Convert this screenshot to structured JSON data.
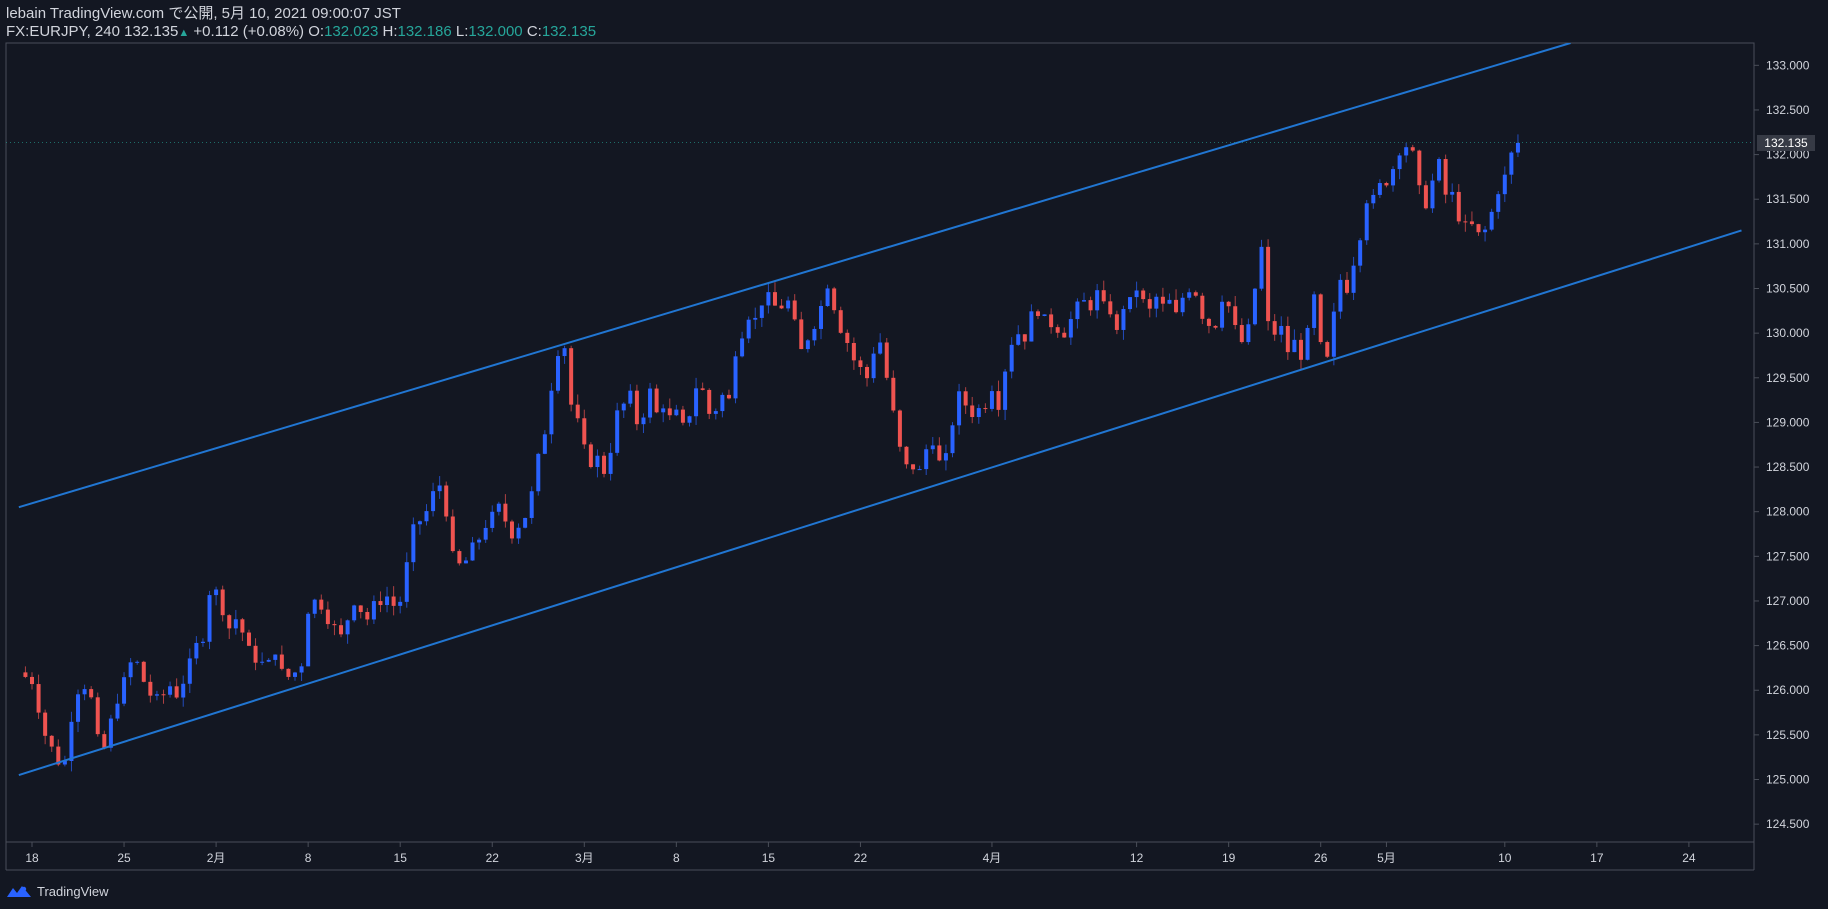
{
  "header": {
    "line1": "lebain TradingView.com で公開, 5月 10, 2021 09:00:07 JST",
    "symbol": "FX:EURJPY, 240",
    "last": "132.135",
    "up_glyph": "▲",
    "change": "+0.112 (+0.08%)",
    "o_label": "O:",
    "o": "132.023",
    "h_label": "H:",
    "h": "132.186",
    "l_label": "L:",
    "l": "132.000",
    "c_label": "C:",
    "c": "132.135"
  },
  "footer": {
    "brand": "TradingView",
    "logo_icon": "tradingview-logo-icon"
  },
  "colors": {
    "background": "#131722",
    "up": "#2962ff",
    "up_line": "#2e7bd6",
    "down": "#ef5350",
    "channel": "#2176d2",
    "axis_text": "#d1d4dc",
    "axis_line": "#4a4e59"
  },
  "chart_data": {
    "type": "candlestick",
    "symbol": "FX:EURJPY",
    "timeframe": "240",
    "ylim": [
      124.3,
      133.25
    ],
    "y_ticks": [
      "124.500",
      "125.000",
      "125.500",
      "126.000",
      "126.500",
      "127.000",
      "127.500",
      "128.000",
      "128.500",
      "129.000",
      "129.500",
      "130.000",
      "130.500",
      "131.000",
      "131.500",
      "132.000",
      "132.500",
      "133.000"
    ],
    "x_ticks": [
      {
        "label": "18",
        "day": 0
      },
      {
        "label": "25",
        "day": 7
      },
      {
        "label": "2月",
        "day": 14
      },
      {
        "label": "8",
        "day": 21
      },
      {
        "label": "15",
        "day": 28
      },
      {
        "label": "22",
        "day": 35
      },
      {
        "label": "3月",
        "day": 42
      },
      {
        "label": "8",
        "day": 49
      },
      {
        "label": "15",
        "day": 56
      },
      {
        "label": "22",
        "day": 63
      },
      {
        "label": "4月",
        "day": 73
      },
      {
        "label": "12",
        "day": 84
      },
      {
        "label": "19",
        "day": 91
      },
      {
        "label": "26",
        "day": 98
      },
      {
        "label": "5月",
        "day": 103
      },
      {
        "label": "10",
        "day": 112
      },
      {
        "label": "17",
        "day": 119
      },
      {
        "label": "24",
        "day": 126
      }
    ],
    "last_price": "132.135",
    "close_path": [
      [
        -1,
        126.2
      ],
      [
        0,
        126.1
      ],
      [
        1,
        125.5
      ],
      [
        2,
        125.2
      ],
      [
        2.5,
        125.2
      ],
      [
        3,
        125.7
      ],
      [
        3.5,
        126.0
      ],
      [
        4,
        126.05
      ],
      [
        4.5,
        125.9
      ],
      [
        5,
        125.45
      ],
      [
        5.5,
        125.35
      ],
      [
        6,
        125.65
      ],
      [
        6.5,
        125.9
      ],
      [
        7,
        126.1
      ],
      [
        7.5,
        126.3
      ],
      [
        8,
        126.3
      ],
      [
        8.5,
        126.1
      ],
      [
        9,
        125.95
      ],
      [
        9.5,
        125.9
      ],
      [
        10,
        125.95
      ],
      [
        10.5,
        126.05
      ],
      [
        11,
        125.95
      ],
      [
        11.5,
        126.1
      ],
      [
        12,
        126.3
      ],
      [
        12.5,
        126.5
      ],
      [
        13,
        126.6
      ],
      [
        13.5,
        127.1
      ],
      [
        14,
        127.1
      ],
      [
        14.5,
        126.9
      ],
      [
        15,
        126.7
      ],
      [
        15.5,
        126.8
      ],
      [
        16,
        126.65
      ],
      [
        16.5,
        126.45
      ],
      [
        17,
        126.35
      ],
      [
        17.5,
        126.3
      ],
      [
        18,
        126.3
      ],
      [
        18.5,
        126.45
      ],
      [
        19,
        126.2
      ],
      [
        19.5,
        126.15
      ],
      [
        20,
        126.2
      ],
      [
        20.5,
        126.3
      ],
      [
        21,
        126.9
      ],
      [
        21.5,
        127.0
      ],
      [
        22,
        126.95
      ],
      [
        22.5,
        126.8
      ],
      [
        23,
        126.7
      ],
      [
        23.5,
        126.6
      ],
      [
        24,
        126.8
      ],
      [
        24.5,
        127.0
      ],
      [
        25,
        126.9
      ],
      [
        25.5,
        126.8
      ],
      [
        26,
        126.95
      ],
      [
        26.5,
        127.0
      ],
      [
        27,
        127.05
      ],
      [
        27.5,
        126.95
      ],
      [
        28,
        127.0
      ],
      [
        28.5,
        127.4
      ],
      [
        29,
        127.8
      ],
      [
        29.5,
        127.9
      ],
      [
        30,
        128.0
      ],
      [
        30.5,
        128.2
      ],
      [
        31,
        128.3
      ],
      [
        31.5,
        128.0
      ],
      [
        32,
        127.5
      ],
      [
        32.5,
        127.4
      ],
      [
        33,
        127.45
      ],
      [
        33.5,
        127.6
      ],
      [
        34,
        127.7
      ],
      [
        34.5,
        127.85
      ],
      [
        35,
        127.95
      ],
      [
        35.5,
        128.05
      ],
      [
        36,
        127.9
      ],
      [
        36.5,
        127.75
      ],
      [
        37,
        127.85
      ],
      [
        37.5,
        127.95
      ],
      [
        38,
        128.2
      ],
      [
        38.5,
        128.6
      ],
      [
        39,
        128.9
      ],
      [
        39.5,
        129.4
      ],
      [
        40,
        129.8
      ],
      [
        40.5,
        129.85
      ],
      [
        41,
        129.2
      ],
      [
        41.5,
        129.0
      ],
      [
        42,
        128.7
      ],
      [
        42.5,
        128.55
      ],
      [
        43,
        128.6
      ],
      [
        43.5,
        128.45
      ],
      [
        44,
        128.7
      ],
      [
        44.5,
        129.1
      ],
      [
        45,
        129.2
      ],
      [
        45.5,
        129.3
      ],
      [
        46,
        129.0
      ],
      [
        46.5,
        129.1
      ],
      [
        47,
        129.35
      ],
      [
        47.5,
        129.1
      ],
      [
        48,
        129.2
      ],
      [
        48.5,
        129.05
      ],
      [
        49,
        129.1
      ],
      [
        49.5,
        128.95
      ],
      [
        50,
        129.1
      ],
      [
        50.5,
        129.4
      ],
      [
        51,
        129.35
      ],
      [
        51.5,
        129.1
      ],
      [
        52,
        129.15
      ],
      [
        52.5,
        129.3
      ],
      [
        53,
        129.25
      ],
      [
        53.5,
        129.8
      ],
      [
        54,
        130.0
      ],
      [
        54.5,
        130.2
      ],
      [
        55,
        130.15
      ],
      [
        55.5,
        130.35
      ],
      [
        56,
        130.4
      ],
      [
        56.5,
        130.3
      ],
      [
        57,
        130.3
      ],
      [
        57.5,
        130.35
      ],
      [
        58,
        130.1
      ],
      [
        58.5,
        129.8
      ],
      [
        59,
        129.95
      ],
      [
        59.5,
        130.1
      ],
      [
        60,
        130.3
      ],
      [
        60.5,
        130.55
      ],
      [
        61,
        130.3
      ],
      [
        61.5,
        130.05
      ],
      [
        62,
        129.9
      ],
      [
        62.5,
        129.7
      ],
      [
        63,
        129.6
      ],
      [
        63.5,
        129.5
      ],
      [
        64,
        129.8
      ],
      [
        64.5,
        129.9
      ],
      [
        65,
        129.5
      ],
      [
        65.5,
        129.1
      ],
      [
        66,
        128.7
      ],
      [
        66.5,
        128.5
      ],
      [
        67,
        128.5
      ],
      [
        67.5,
        128.45
      ],
      [
        68,
        128.7
      ],
      [
        68.5,
        128.8
      ],
      [
        69,
        128.55
      ],
      [
        69.5,
        128.6
      ],
      [
        70,
        129.0
      ],
      [
        70.5,
        129.3
      ],
      [
        71,
        129.2
      ],
      [
        71.5,
        129.1
      ],
      [
        72,
        129.15
      ],
      [
        72.5,
        129.2
      ],
      [
        73,
        129.4
      ],
      [
        73.5,
        129.2
      ],
      [
        74,
        129.6
      ],
      [
        74.5,
        129.9
      ],
      [
        75,
        130.0
      ],
      [
        75.5,
        129.95
      ],
      [
        76,
        130.2
      ],
      [
        76.5,
        130.25
      ],
      [
        77,
        130.15
      ],
      [
        77.5,
        130.1
      ],
      [
        78,
        130.05
      ],
      [
        78.5,
        130.0
      ],
      [
        79,
        130.15
      ],
      [
        79.5,
        130.3
      ],
      [
        80,
        130.35
      ],
      [
        80.5,
        130.3
      ],
      [
        81,
        130.45
      ],
      [
        81.5,
        130.3
      ],
      [
        82,
        130.25
      ],
      [
        82.5,
        130.0
      ],
      [
        83,
        130.3
      ],
      [
        83.5,
        130.35
      ],
      [
        84,
        130.5
      ],
      [
        84.5,
        130.35
      ],
      [
        85,
        130.25
      ],
      [
        85.5,
        130.4
      ],
      [
        86,
        130.3
      ],
      [
        86.5,
        130.35
      ],
      [
        87,
        130.2
      ],
      [
        87.5,
        130.4
      ],
      [
        88,
        130.5
      ],
      [
        88.5,
        130.45
      ],
      [
        89,
        130.2
      ],
      [
        89.5,
        130.1
      ],
      [
        90,
        130.1
      ],
      [
        90.5,
        130.4
      ],
      [
        91,
        130.3
      ],
      [
        91.5,
        130.05
      ],
      [
        92,
        129.9
      ],
      [
        92.5,
        130.05
      ],
      [
        93,
        130.5
      ],
      [
        93.5,
        130.95
      ],
      [
        94,
        130.1
      ],
      [
        94.5,
        130.0
      ],
      [
        95,
        130.05
      ],
      [
        95.5,
        129.8
      ],
      [
        96,
        129.9
      ],
      [
        96.5,
        129.75
      ],
      [
        97,
        130.0
      ],
      [
        97.5,
        130.4
      ],
      [
        98,
        129.85
      ],
      [
        98.5,
        129.7
      ],
      [
        99,
        130.2
      ],
      [
        99.5,
        130.6
      ],
      [
        100,
        130.5
      ],
      [
        100.5,
        130.8
      ],
      [
        101,
        131.1
      ],
      [
        101.5,
        131.5
      ],
      [
        102,
        131.5
      ],
      [
        102.5,
        131.65
      ],
      [
        103,
        131.7
      ],
      [
        103.5,
        131.85
      ],
      [
        104,
        132.05
      ],
      [
        104.5,
        132.1
      ],
      [
        105,
        132.0
      ],
      [
        105.5,
        131.6
      ],
      [
        106,
        131.45
      ],
      [
        106.5,
        131.7
      ],
      [
        107,
        131.9
      ],
      [
        107.5,
        131.55
      ],
      [
        108,
        131.55
      ],
      [
        108.5,
        131.3
      ],
      [
        109,
        131.2
      ],
      [
        109.5,
        131.2
      ],
      [
        110,
        131.1
      ],
      [
        110.5,
        131.15
      ],
      [
        111,
        131.35
      ],
      [
        111.5,
        131.6
      ],
      [
        112,
        131.75
      ],
      [
        112.5,
        132.0
      ],
      [
        113,
        132.13
      ]
    ],
    "channel": {
      "upper": [
        [
          -1,
          128.05
        ],
        [
          117,
          133.25
        ]
      ],
      "lower": [
        [
          -1,
          125.05
        ],
        [
          130,
          131.15
        ]
      ]
    }
  }
}
